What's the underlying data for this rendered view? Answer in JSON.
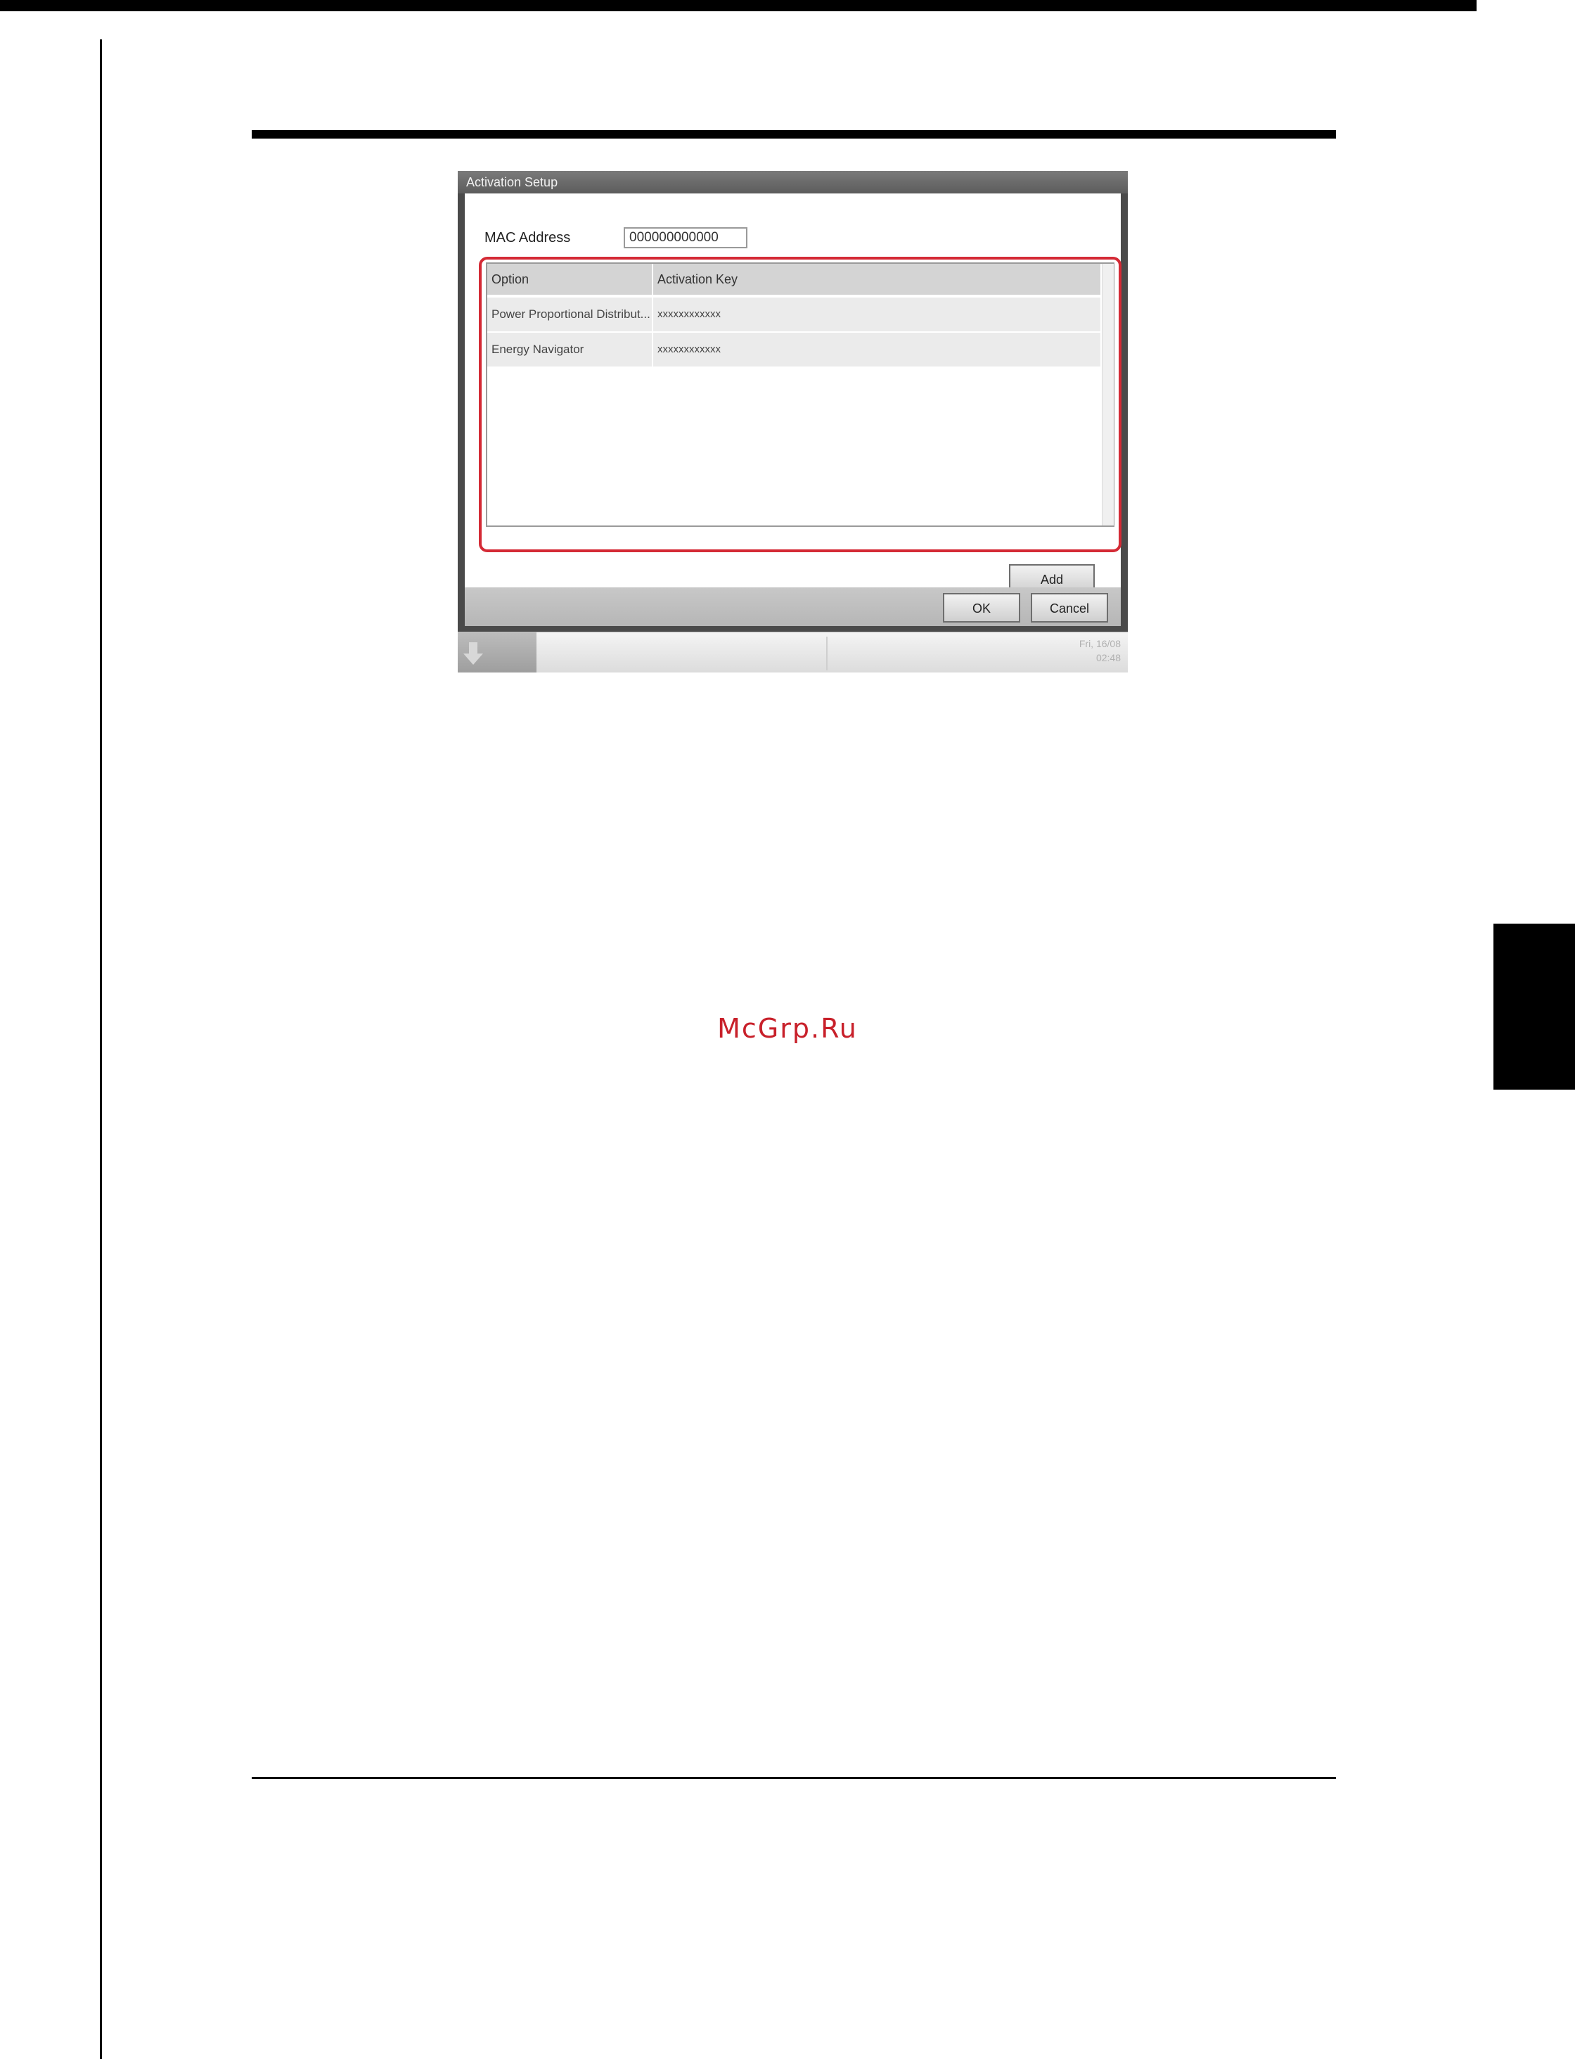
{
  "watermark": "McGrp.Ru",
  "dialog": {
    "title": "Activation Setup",
    "mac_label": "MAC Address",
    "mac_value": "000000000000",
    "table": {
      "headers": [
        "Option",
        "Activation Key"
      ],
      "rows": [
        {
          "option": "Power Proportional Distribut...",
          "key": "xxxxxxxxxxxx"
        },
        {
          "option": "Energy Navigator",
          "key": "xxxxxxxxxxxx"
        }
      ]
    },
    "add_label": "Add",
    "ok_label": "OK",
    "cancel_label": "Cancel"
  },
  "taskbar": {
    "date": "Fri, 16/08",
    "time": "02:48",
    "start_icon": "arrow-down-icon"
  },
  "colors": {
    "highlight": "#d42a35",
    "frame": "#4a4a4a"
  }
}
